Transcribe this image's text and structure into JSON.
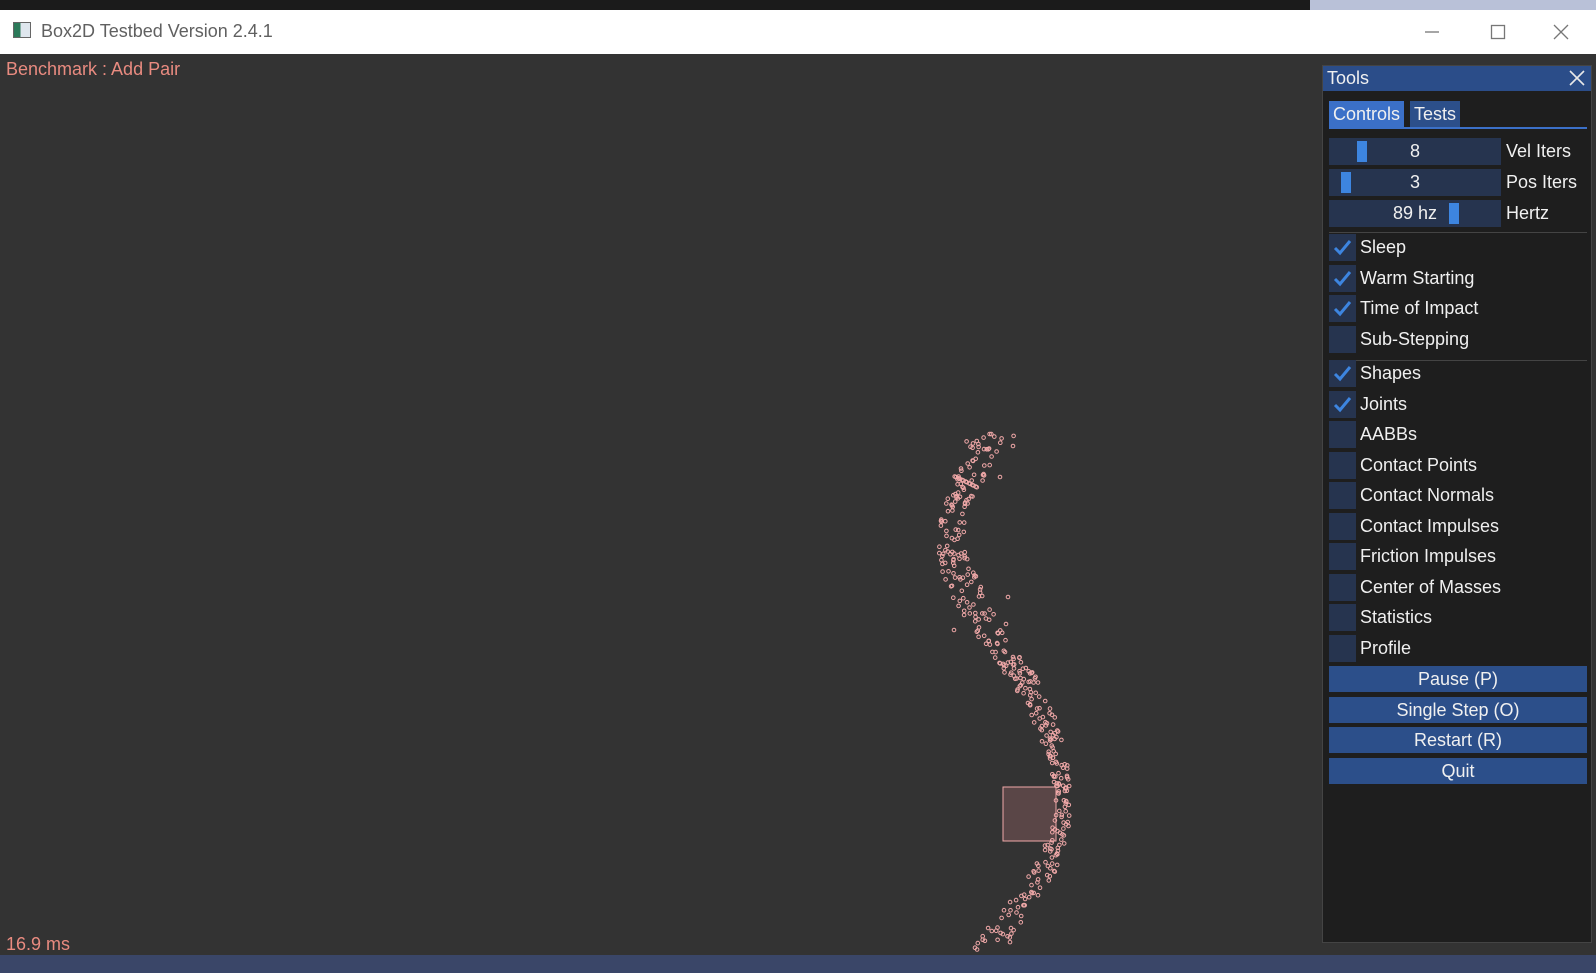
{
  "window": {
    "title": "Box2D Testbed Version 2.4.1",
    "controls": [
      "minimize-icon",
      "maximize-icon",
      "close-icon"
    ]
  },
  "viewport": {
    "scene_title": "Benchmark : Add Pair",
    "frame_time": "16.9 ms",
    "colors": {
      "background": "#333333",
      "text": "#e98b80",
      "particles": "#f0a8a8",
      "box_fill": "#5a4647"
    }
  },
  "tools": {
    "title": "Tools",
    "close_icon": "close-icon",
    "tabs": [
      {
        "label": "Controls",
        "active": true
      },
      {
        "label": "Tests",
        "active": false
      }
    ],
    "sliders": [
      {
        "label": "Vel Iters",
        "value": "8"
      },
      {
        "label": "Pos Iters",
        "value": "3"
      },
      {
        "label": "Hertz",
        "value": "89 hz"
      }
    ],
    "solver_options": [
      {
        "label": "Sleep",
        "checked": true
      },
      {
        "label": "Warm Starting",
        "checked": true
      },
      {
        "label": "Time of Impact",
        "checked": true
      },
      {
        "label": "Sub-Stepping",
        "checked": false
      }
    ],
    "draw_options": [
      {
        "label": "Shapes",
        "checked": true
      },
      {
        "label": "Joints",
        "checked": true
      },
      {
        "label": "AABBs",
        "checked": false
      },
      {
        "label": "Contact Points",
        "checked": false
      },
      {
        "label": "Contact Normals",
        "checked": false
      },
      {
        "label": "Contact Impulses",
        "checked": false
      },
      {
        "label": "Friction Impulses",
        "checked": false
      },
      {
        "label": "Center of Masses",
        "checked": false
      },
      {
        "label": "Statistics",
        "checked": false
      },
      {
        "label": "Profile",
        "checked": false
      }
    ],
    "buttons": [
      {
        "label": "Pause (P)"
      },
      {
        "label": "Single Step (O)"
      },
      {
        "label": "Restart (R)"
      },
      {
        "label": "Quit"
      }
    ],
    "colors": {
      "accent": "#3b70c8",
      "button": "#2c4f8a",
      "frame": "#26344f",
      "check": "#3d85e0"
    }
  }
}
